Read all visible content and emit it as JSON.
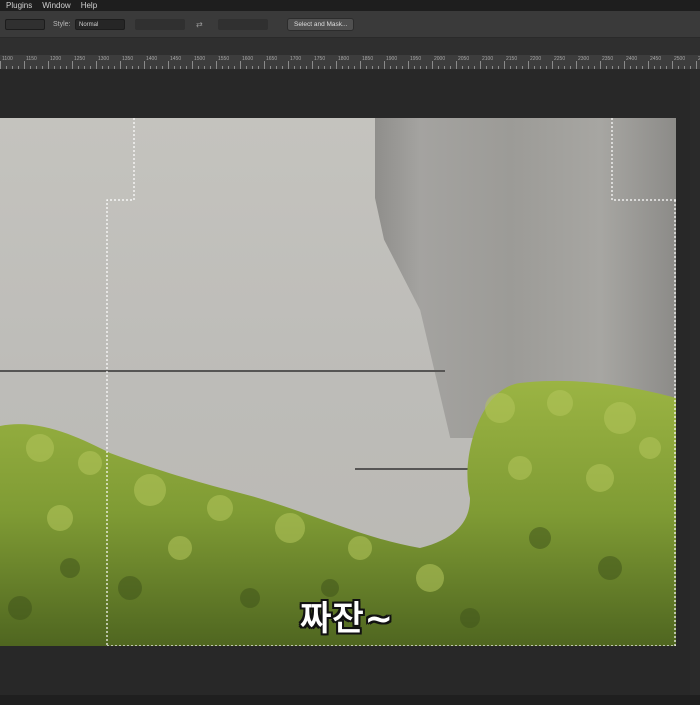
{
  "menu": {
    "items": [
      "Plugins",
      "Window",
      "Help"
    ]
  },
  "options": {
    "style_label": "Style:",
    "style_value": "Normal",
    "select_mask_label": "Select and Mask..."
  },
  "ruler": {
    "labels": [
      "1100",
      "1150",
      "1200",
      "1250",
      "1300",
      "1350",
      "1400",
      "1450",
      "1500",
      "1550",
      "1600",
      "1650",
      "1700",
      "1750",
      "1800",
      "1850",
      "1900",
      "1950",
      "2000",
      "2050",
      "2100",
      "2150",
      "2200",
      "2250",
      "2300",
      "2350",
      "2400",
      "2450",
      "2500",
      "2550"
    ]
  },
  "canvas": {
    "subtitle": "짜잔~"
  },
  "colors": {
    "ui_dark": "#262626",
    "options_bar": "#3a3a3a",
    "foliage": "#7e9a34",
    "wall": "#c2c1bc"
  }
}
